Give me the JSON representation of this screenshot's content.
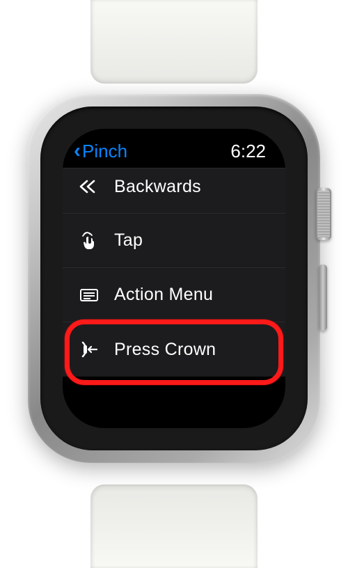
{
  "statusBar": {
    "backLabel": "Pinch",
    "time": "6:22"
  },
  "list": {
    "items": [
      {
        "icon": "backwards",
        "label": "Backwards",
        "highlighted": false,
        "partial": true
      },
      {
        "icon": "tap",
        "label": "Tap",
        "highlighted": false
      },
      {
        "icon": "action-menu",
        "label": "Action Menu",
        "highlighted": false
      },
      {
        "icon": "press-crown",
        "label": "Press Crown",
        "highlighted": true
      }
    ]
  },
  "colors": {
    "accent": "#0a84ff",
    "highlight": "#ff1a1a",
    "background": "#000000",
    "rowBackground": "#1c1c1e",
    "text": "#ffffff"
  }
}
